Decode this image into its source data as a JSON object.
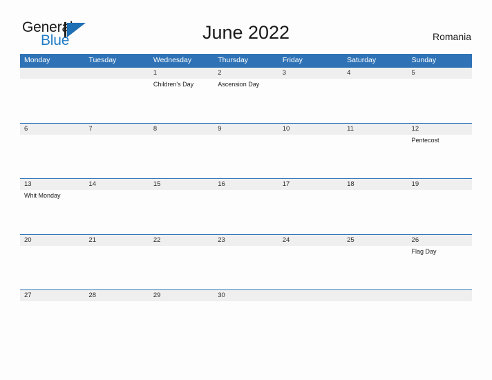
{
  "brand": {
    "name_part1": "General",
    "name_part2": "Blue",
    "logo_icon": "triangle-flag-icon",
    "accent_color": "#1f6fb4"
  },
  "header": {
    "title": "June 2022",
    "region": "Romania"
  },
  "colors": {
    "header_blue": "#2f73b6",
    "day_band_gray": "#efefef",
    "text_dark": "#1b1b1b",
    "logo_blue": "#1f7bc4",
    "page_background": "#fdfdfd"
  },
  "calendar": {
    "weekdays": [
      "Monday",
      "Tuesday",
      "Wednesday",
      "Thursday",
      "Friday",
      "Saturday",
      "Sunday"
    ],
    "weeks": [
      {
        "days": [
          {
            "date": "",
            "event": ""
          },
          {
            "date": "",
            "event": ""
          },
          {
            "date": "1",
            "event": "Children's Day"
          },
          {
            "date": "2",
            "event": "Ascension Day"
          },
          {
            "date": "3",
            "event": ""
          },
          {
            "date": "4",
            "event": ""
          },
          {
            "date": "5",
            "event": ""
          }
        ]
      },
      {
        "days": [
          {
            "date": "6",
            "event": ""
          },
          {
            "date": "7",
            "event": ""
          },
          {
            "date": "8",
            "event": ""
          },
          {
            "date": "9",
            "event": ""
          },
          {
            "date": "10",
            "event": ""
          },
          {
            "date": "11",
            "event": ""
          },
          {
            "date": "12",
            "event": "Pentecost"
          }
        ]
      },
      {
        "days": [
          {
            "date": "13",
            "event": "Whit Monday"
          },
          {
            "date": "14",
            "event": ""
          },
          {
            "date": "15",
            "event": ""
          },
          {
            "date": "16",
            "event": ""
          },
          {
            "date": "17",
            "event": ""
          },
          {
            "date": "18",
            "event": ""
          },
          {
            "date": "19",
            "event": ""
          }
        ]
      },
      {
        "days": [
          {
            "date": "20",
            "event": ""
          },
          {
            "date": "21",
            "event": ""
          },
          {
            "date": "22",
            "event": ""
          },
          {
            "date": "23",
            "event": ""
          },
          {
            "date": "24",
            "event": ""
          },
          {
            "date": "25",
            "event": ""
          },
          {
            "date": "26",
            "event": "Flag Day"
          }
        ]
      },
      {
        "days": [
          {
            "date": "27",
            "event": ""
          },
          {
            "date": "28",
            "event": ""
          },
          {
            "date": "29",
            "event": ""
          },
          {
            "date": "30",
            "event": ""
          },
          {
            "date": "",
            "event": ""
          },
          {
            "date": "",
            "event": ""
          },
          {
            "date": "",
            "event": ""
          }
        ]
      }
    ]
  }
}
